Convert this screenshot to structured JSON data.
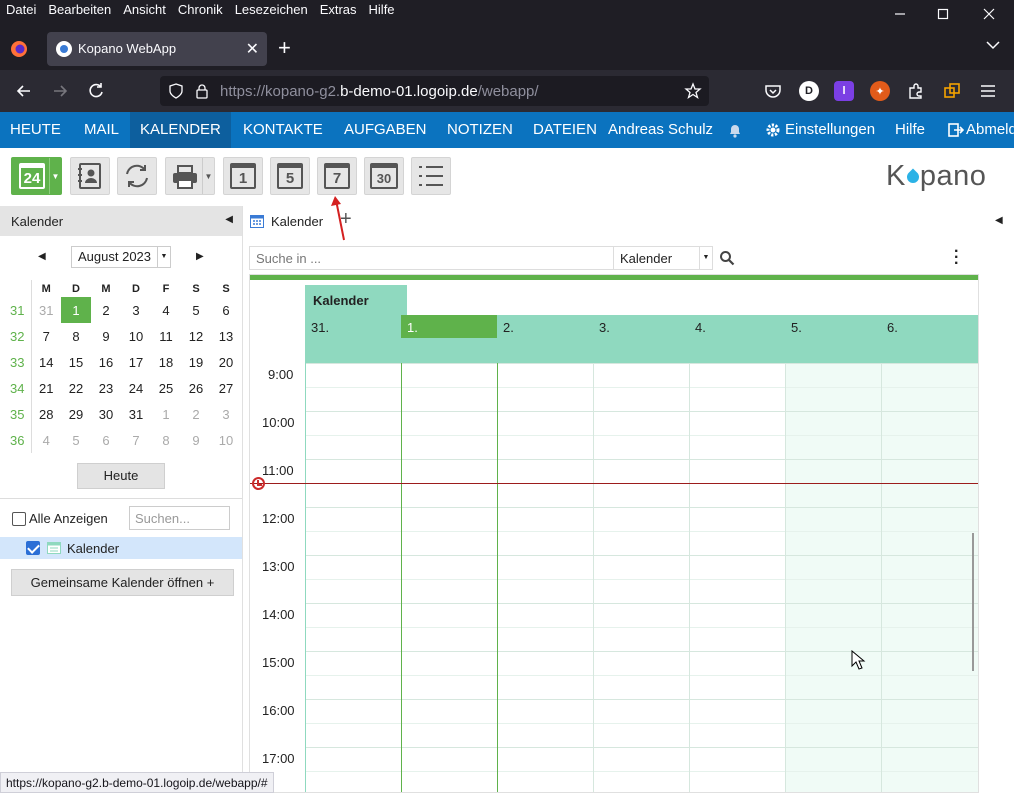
{
  "browser": {
    "menu": [
      "Datei",
      "Bearbeiten",
      "Ansicht",
      "Chronik",
      "Lesezeichen",
      "Extras",
      "Hilfe"
    ],
    "tab_title": "Kopano WebApp",
    "url_prefix": "https://kopano-g2.",
    "url_host": "b-demo-01.logoip.de",
    "url_suffix": "/webapp/",
    "status_url": "https://kopano-g2.b-demo-01.logoip.de/webapp/#"
  },
  "appnav": {
    "items": [
      "HEUTE",
      "MAIL",
      "KALENDER",
      "KONTAKTE",
      "AUFGABEN",
      "NOTIZEN",
      "DATEIEN"
    ],
    "user": "Andreas Schulz",
    "settings": "Einstellungen",
    "help": "Hilfe",
    "logout": "Abmelden"
  },
  "toolbar": {
    "new_day": "24",
    "day_view": "1",
    "workweek_view": "5",
    "week_view": "7",
    "month_view": "30",
    "logo": "Kopano"
  },
  "left": {
    "panel_title": "Kalender",
    "month_label": "August 2023",
    "weekday_headers": [
      "M",
      "D",
      "M",
      "D",
      "F",
      "S",
      "S"
    ],
    "weeks": [
      {
        "wk": "31",
        "days": [
          "31",
          "1",
          "2",
          "3",
          "4",
          "5",
          "6"
        ]
      },
      {
        "wk": "32",
        "days": [
          "7",
          "8",
          "9",
          "10",
          "11",
          "12",
          "13"
        ]
      },
      {
        "wk": "33",
        "days": [
          "14",
          "15",
          "16",
          "17",
          "18",
          "19",
          "20"
        ]
      },
      {
        "wk": "34",
        "days": [
          "21",
          "22",
          "23",
          "24",
          "25",
          "26",
          "27"
        ]
      },
      {
        "wk": "35",
        "days": [
          "28",
          "29",
          "30",
          "31",
          "1",
          "2",
          "3"
        ]
      },
      {
        "wk": "36",
        "days": [
          "4",
          "5",
          "6",
          "7",
          "8",
          "9",
          "10"
        ]
      }
    ],
    "today_button": "Heute",
    "show_all": "Alle Anzeigen",
    "search_placeholder": "Suchen...",
    "calendar_item": "Kalender",
    "open_shared": "Gemeinsame Kalender öffnen +"
  },
  "main": {
    "tab_label": "Kalender",
    "search_placeholder": "Suche in ...",
    "search_scope": "Kalender",
    "calendar_name": "Kalender",
    "days": [
      "31.",
      "1.",
      "2.",
      "3.",
      "4.",
      "5.",
      "6."
    ],
    "hours": [
      "9:00",
      "10:00",
      "11:00",
      "12:00",
      "13:00",
      "14:00",
      "15:00",
      "16:00",
      "17:00"
    ]
  },
  "colors": {
    "nav_blue": "#0b73bf",
    "accent_green": "#5fb24b",
    "day_header": "#8fd9bf",
    "now_line": "#9c1c1c"
  }
}
